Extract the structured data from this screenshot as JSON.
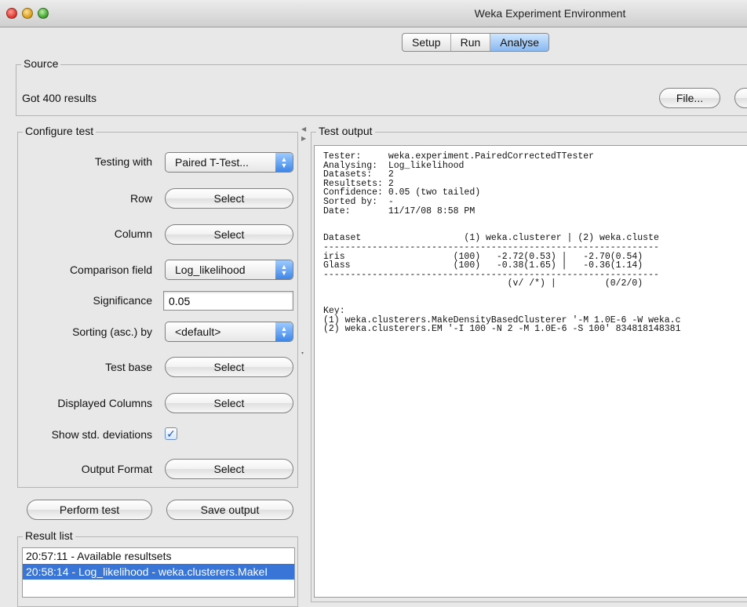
{
  "window": {
    "title": "Weka Experiment Environment"
  },
  "tabs": [
    {
      "label": "Setup",
      "active": false
    },
    {
      "label": "Run",
      "active": false
    },
    {
      "label": "Analyse",
      "active": true
    }
  ],
  "source": {
    "title": "Source",
    "status": "Got 400 results",
    "file_button": "File..."
  },
  "configure": {
    "title": "Configure test",
    "testing_with": {
      "label": "Testing with",
      "value": "Paired T-Test..."
    },
    "row": {
      "label": "Row",
      "button": "Select"
    },
    "column": {
      "label": "Column",
      "button": "Select"
    },
    "comparison_field": {
      "label": "Comparison field",
      "value": "Log_likelihood"
    },
    "significance": {
      "label": "Significance",
      "value": "0.05"
    },
    "sorting": {
      "label": "Sorting (asc.) by",
      "value": "<default>"
    },
    "test_base": {
      "label": "Test base",
      "button": "Select"
    },
    "displayed_columns": {
      "label": "Displayed Columns",
      "button": "Select"
    },
    "show_std": {
      "label": "Show std. deviations",
      "checked": true
    },
    "output_format": {
      "label": "Output Format",
      "button": "Select"
    }
  },
  "actions": {
    "perform_test": "Perform test",
    "save_output": "Save output"
  },
  "result_list": {
    "title": "Result list",
    "items": [
      {
        "text": "20:57:11 - Available resultsets",
        "selected": false
      },
      {
        "text": "20:58:14 - Log_likelihood - weka.clusterers.MakeI",
        "selected": true
      }
    ]
  },
  "test_output": {
    "title": "Test output",
    "text": "Tester:     weka.experiment.PairedCorrectedTTester\nAnalysing:  Log_likelihood\nDatasets:   2\nResultsets: 2\nConfidence: 0.05 (two tailed)\nSorted by:  -\nDate:       11/17/08 8:58 PM\n\n\nDataset                   (1) weka.clusterer | (2) weka.cluste\n--------------------------------------------------------------\niris                    (100)   -2.72(0.53) |   -2.70(0.54)\nGlass                   (100)   -0.38(1.65) |   -0.36(1.14)\n--------------------------------------------------------------\n                                  (v/ /*) |         (0/2/0)\n\n\nKey:\n(1) weka.clusterers.MakeDensityBasedClusterer '-M 1.0E-6 -W weka.c\n(2) weka.clusterers.EM '-I 100 -N 2 -M 1.0E-6 -S 100' 834818148381"
  },
  "colors": {
    "selection": "#3875d7",
    "tab_active": "#88b9f0",
    "checkbox": "#1c52b8"
  }
}
